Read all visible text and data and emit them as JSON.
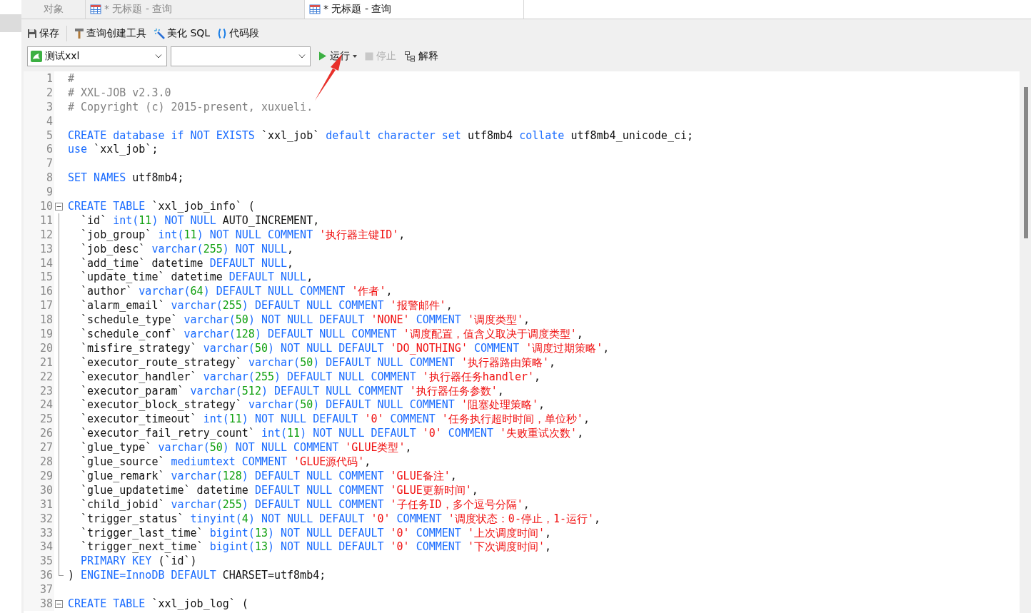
{
  "tabs": [
    {
      "kind": "objects",
      "label": "对象",
      "selected": false
    },
    {
      "kind": "query",
      "label": "* 无标题 - 查询",
      "selected": false
    },
    {
      "kind": "query",
      "label": "* 无标题 - 查询",
      "selected": true
    }
  ],
  "toolbar": [
    {
      "kind": "save",
      "label": "保存"
    },
    {
      "kind": "builder",
      "label": "查询创建工具"
    },
    {
      "kind": "beautify",
      "label": "美化 SQL"
    },
    {
      "kind": "snippet",
      "label": "代码段"
    }
  ],
  "connection": {
    "value": "测试xxl"
  },
  "actions": [
    {
      "kind": "run",
      "label": "运行",
      "disabled": false
    },
    {
      "kind": "stop",
      "label": "停止",
      "disabled": true
    },
    {
      "kind": "explain",
      "label": "解释",
      "disabled": false
    }
  ],
  "code": [
    {
      "no": "1",
      "kind": "text",
      "tokens": [
        {
          "kind": "comment",
          "text": "#"
        }
      ]
    },
    {
      "no": "2",
      "kind": "text",
      "tokens": [
        {
          "kind": "comment",
          "text": "# XXL-JOB v2.3.0"
        }
      ]
    },
    {
      "no": "3",
      "kind": "text",
      "tokens": [
        {
          "kind": "comment",
          "text": "# Copyright (c) 2015-present, xuxueli."
        }
      ]
    },
    {
      "no": "4",
      "kind": "text"
    },
    {
      "no": "5",
      "kind": "text",
      "tokens": [
        {
          "kind": "keyword",
          "text": "CREATE database if NOT EXISTS"
        },
        {
          "kind": "plain",
          "text": " `xxl_job` "
        },
        {
          "kind": "keyword",
          "text": "default character set"
        },
        {
          "kind": "plain",
          "text": " utf8mb4 "
        },
        {
          "kind": "keyword",
          "text": "collate"
        },
        {
          "kind": "plain",
          "text": " utf8mb4_unicode_ci;"
        }
      ]
    },
    {
      "no": "6",
      "kind": "text",
      "tokens": [
        {
          "kind": "keyword",
          "text": "use"
        },
        {
          "kind": "plain",
          "text": " `xxl_job`;"
        }
      ]
    },
    {
      "no": "7",
      "kind": "text"
    },
    {
      "no": "8",
      "kind": "text",
      "tokens": [
        {
          "kind": "keyword",
          "text": "SET NAMES"
        },
        {
          "kind": "plain",
          "text": " utf8mb4;"
        }
      ]
    },
    {
      "no": "9",
      "kind": "text"
    },
    {
      "no": "10",
      "kind": "fold_start",
      "tokens": [
        {
          "kind": "keyword",
          "text": "CREATE TABLE"
        },
        {
          "kind": "plain",
          "text": " `xxl_job_info` ("
        }
      ]
    },
    {
      "no": "11",
      "kind": "fold_body",
      "tokens": [
        {
          "kind": "plain",
          "text": "  `id` "
        },
        {
          "kind": "keyword",
          "text": "int("
        },
        {
          "kind": "number",
          "text": "11"
        },
        {
          "kind": "keyword",
          "text": ") NOT NULL"
        },
        {
          "kind": "plain",
          "text": " AUTO_INCREMENT,"
        }
      ]
    },
    {
      "no": "12",
      "kind": "fold_body",
      "tokens": [
        {
          "kind": "plain",
          "text": "  `job_group` "
        },
        {
          "kind": "keyword",
          "text": "int("
        },
        {
          "kind": "number",
          "text": "11"
        },
        {
          "kind": "keyword",
          "text": ") NOT NULL COMMENT "
        },
        {
          "kind": "string",
          "text": "'执行器主键ID'"
        },
        {
          "kind": "plain",
          "text": ","
        }
      ]
    },
    {
      "no": "13",
      "kind": "fold_body",
      "tokens": [
        {
          "kind": "plain",
          "text": "  `job_desc` "
        },
        {
          "kind": "keyword",
          "text": "varchar("
        },
        {
          "kind": "number",
          "text": "255"
        },
        {
          "kind": "keyword",
          "text": ") NOT NULL"
        },
        {
          "kind": "plain",
          "text": ","
        }
      ]
    },
    {
      "no": "14",
      "kind": "fold_body",
      "tokens": [
        {
          "kind": "plain",
          "text": "  `add_time` datetime "
        },
        {
          "kind": "keyword",
          "text": "DEFAULT NULL"
        },
        {
          "kind": "plain",
          "text": ","
        }
      ]
    },
    {
      "no": "15",
      "kind": "fold_body",
      "tokens": [
        {
          "kind": "plain",
          "text": "  `update_time` datetime "
        },
        {
          "kind": "keyword",
          "text": "DEFAULT NULL"
        },
        {
          "kind": "plain",
          "text": ","
        }
      ]
    },
    {
      "no": "16",
      "kind": "fold_body",
      "tokens": [
        {
          "kind": "plain",
          "text": "  `author` "
        },
        {
          "kind": "keyword",
          "text": "varchar("
        },
        {
          "kind": "number",
          "text": "64"
        },
        {
          "kind": "keyword",
          "text": ") DEFAULT NULL COMMENT "
        },
        {
          "kind": "string",
          "text": "'作者'"
        },
        {
          "kind": "plain",
          "text": ","
        }
      ]
    },
    {
      "no": "17",
      "kind": "fold_body",
      "tokens": [
        {
          "kind": "plain",
          "text": "  `alarm_email` "
        },
        {
          "kind": "keyword",
          "text": "varchar("
        },
        {
          "kind": "number",
          "text": "255"
        },
        {
          "kind": "keyword",
          "text": ") DEFAULT NULL COMMENT "
        },
        {
          "kind": "string",
          "text": "'报警邮件'"
        },
        {
          "kind": "plain",
          "text": ","
        }
      ]
    },
    {
      "no": "18",
      "kind": "fold_body",
      "tokens": [
        {
          "kind": "plain",
          "text": "  `schedule_type` "
        },
        {
          "kind": "keyword",
          "text": "varchar("
        },
        {
          "kind": "number",
          "text": "50"
        },
        {
          "kind": "keyword",
          "text": ") NOT NULL DEFAULT "
        },
        {
          "kind": "string",
          "text": "'NONE'"
        },
        {
          "kind": "keyword",
          "text": " COMMENT "
        },
        {
          "kind": "string",
          "text": "'调度类型'"
        },
        {
          "kind": "plain",
          "text": ","
        }
      ]
    },
    {
      "no": "19",
      "kind": "fold_body",
      "tokens": [
        {
          "kind": "plain",
          "text": "  `schedule_conf` "
        },
        {
          "kind": "keyword",
          "text": "varchar("
        },
        {
          "kind": "number",
          "text": "128"
        },
        {
          "kind": "keyword",
          "text": ") DEFAULT NULL COMMENT "
        },
        {
          "kind": "string",
          "text": "'调度配置，值含义取决于调度类型'"
        },
        {
          "kind": "plain",
          "text": ","
        }
      ]
    },
    {
      "no": "20",
      "kind": "fold_body",
      "tokens": [
        {
          "kind": "plain",
          "text": "  `misfire_strategy` "
        },
        {
          "kind": "keyword",
          "text": "varchar("
        },
        {
          "kind": "number",
          "text": "50"
        },
        {
          "kind": "keyword",
          "text": ") NOT NULL DEFAULT "
        },
        {
          "kind": "string",
          "text": "'DO_NOTHING'"
        },
        {
          "kind": "keyword",
          "text": " COMMENT "
        },
        {
          "kind": "string",
          "text": "'调度过期策略'"
        },
        {
          "kind": "plain",
          "text": ","
        }
      ]
    },
    {
      "no": "21",
      "kind": "fold_body",
      "tokens": [
        {
          "kind": "plain",
          "text": "  `executor_route_strategy` "
        },
        {
          "kind": "keyword",
          "text": "varchar("
        },
        {
          "kind": "number",
          "text": "50"
        },
        {
          "kind": "keyword",
          "text": ") DEFAULT NULL COMMENT "
        },
        {
          "kind": "string",
          "text": "'执行器路由策略'"
        },
        {
          "kind": "plain",
          "text": ","
        }
      ]
    },
    {
      "no": "22",
      "kind": "fold_body",
      "tokens": [
        {
          "kind": "plain",
          "text": "  `executor_handler` "
        },
        {
          "kind": "keyword",
          "text": "varchar("
        },
        {
          "kind": "number",
          "text": "255"
        },
        {
          "kind": "keyword",
          "text": ") DEFAULT NULL COMMENT "
        },
        {
          "kind": "string",
          "text": "'执行器任务handler'"
        },
        {
          "kind": "plain",
          "text": ","
        }
      ]
    },
    {
      "no": "23",
      "kind": "fold_body",
      "tokens": [
        {
          "kind": "plain",
          "text": "  `executor_param` "
        },
        {
          "kind": "keyword",
          "text": "varchar("
        },
        {
          "kind": "number",
          "text": "512"
        },
        {
          "kind": "keyword",
          "text": ") DEFAULT NULL COMMENT "
        },
        {
          "kind": "string",
          "text": "'执行器任务参数'"
        },
        {
          "kind": "plain",
          "text": ","
        }
      ]
    },
    {
      "no": "24",
      "kind": "fold_body",
      "tokens": [
        {
          "kind": "plain",
          "text": "  `executor_block_strategy` "
        },
        {
          "kind": "keyword",
          "text": "varchar("
        },
        {
          "kind": "number",
          "text": "50"
        },
        {
          "kind": "keyword",
          "text": ") DEFAULT NULL COMMENT "
        },
        {
          "kind": "string",
          "text": "'阻塞处理策略'"
        },
        {
          "kind": "plain",
          "text": ","
        }
      ]
    },
    {
      "no": "25",
      "kind": "fold_body",
      "tokens": [
        {
          "kind": "plain",
          "text": "  `executor_timeout` "
        },
        {
          "kind": "keyword",
          "text": "int("
        },
        {
          "kind": "number",
          "text": "11"
        },
        {
          "kind": "keyword",
          "text": ") NOT NULL DEFAULT "
        },
        {
          "kind": "string",
          "text": "'0'"
        },
        {
          "kind": "keyword",
          "text": " COMMENT "
        },
        {
          "kind": "string",
          "text": "'任务执行超时时间，单位秒'"
        },
        {
          "kind": "plain",
          "text": ","
        }
      ]
    },
    {
      "no": "26",
      "kind": "fold_body",
      "tokens": [
        {
          "kind": "plain",
          "text": "  `executor_fail_retry_count` "
        },
        {
          "kind": "keyword",
          "text": "int("
        },
        {
          "kind": "number",
          "text": "11"
        },
        {
          "kind": "keyword",
          "text": ") NOT NULL DEFAULT "
        },
        {
          "kind": "string",
          "text": "'0'"
        },
        {
          "kind": "keyword",
          "text": " COMMENT "
        },
        {
          "kind": "string",
          "text": "'失败重试次数'"
        },
        {
          "kind": "plain",
          "text": ","
        }
      ]
    },
    {
      "no": "27",
      "kind": "fold_body",
      "tokens": [
        {
          "kind": "plain",
          "text": "  `glue_type` "
        },
        {
          "kind": "keyword",
          "text": "varchar("
        },
        {
          "kind": "number",
          "text": "50"
        },
        {
          "kind": "keyword",
          "text": ") NOT NULL COMMENT "
        },
        {
          "kind": "string",
          "text": "'GLUE类型'"
        },
        {
          "kind": "plain",
          "text": ","
        }
      ]
    },
    {
      "no": "28",
      "kind": "fold_body",
      "tokens": [
        {
          "kind": "plain",
          "text": "  `glue_source` "
        },
        {
          "kind": "keyword",
          "text": "mediumtext COMMENT "
        },
        {
          "kind": "string",
          "text": "'GLUE源代码'"
        },
        {
          "kind": "plain",
          "text": ","
        }
      ]
    },
    {
      "no": "29",
      "kind": "fold_body",
      "tokens": [
        {
          "kind": "plain",
          "text": "  `glue_remark` "
        },
        {
          "kind": "keyword",
          "text": "varchar("
        },
        {
          "kind": "number",
          "text": "128"
        },
        {
          "kind": "keyword",
          "text": ") DEFAULT NULL COMMENT "
        },
        {
          "kind": "string",
          "text": "'GLUE备注'"
        },
        {
          "kind": "plain",
          "text": ","
        }
      ]
    },
    {
      "no": "30",
      "kind": "fold_body",
      "tokens": [
        {
          "kind": "plain",
          "text": "  `glue_updatetime` datetime "
        },
        {
          "kind": "keyword",
          "text": "DEFAULT NULL COMMENT "
        },
        {
          "kind": "string",
          "text": "'GLUE更新时间'"
        },
        {
          "kind": "plain",
          "text": ","
        }
      ]
    },
    {
      "no": "31",
      "kind": "fold_body",
      "tokens": [
        {
          "kind": "plain",
          "text": "  `child_jobid` "
        },
        {
          "kind": "keyword",
          "text": "varchar("
        },
        {
          "kind": "number",
          "text": "255"
        },
        {
          "kind": "keyword",
          "text": ") DEFAULT NULL COMMENT "
        },
        {
          "kind": "string",
          "text": "'子任务ID，多个逗号分隔'"
        },
        {
          "kind": "plain",
          "text": ","
        }
      ]
    },
    {
      "no": "32",
      "kind": "fold_body",
      "tokens": [
        {
          "kind": "plain",
          "text": "  `trigger_status` "
        },
        {
          "kind": "keyword",
          "text": "tinyint("
        },
        {
          "kind": "number",
          "text": "4"
        },
        {
          "kind": "keyword",
          "text": ") NOT NULL DEFAULT "
        },
        {
          "kind": "string",
          "text": "'0'"
        },
        {
          "kind": "keyword",
          "text": " COMMENT "
        },
        {
          "kind": "string",
          "text": "'调度状态：0-停止，1-运行'"
        },
        {
          "kind": "plain",
          "text": ","
        }
      ]
    },
    {
      "no": "33",
      "kind": "fold_body",
      "tokens": [
        {
          "kind": "plain",
          "text": "  `trigger_last_time` "
        },
        {
          "kind": "keyword",
          "text": "bigint("
        },
        {
          "kind": "number",
          "text": "13"
        },
        {
          "kind": "keyword",
          "text": ") NOT NULL DEFAULT "
        },
        {
          "kind": "string",
          "text": "'0'"
        },
        {
          "kind": "keyword",
          "text": " COMMENT "
        },
        {
          "kind": "string",
          "text": "'上次调度时间'"
        },
        {
          "kind": "plain",
          "text": ","
        }
      ]
    },
    {
      "no": "34",
      "kind": "fold_body",
      "tokens": [
        {
          "kind": "plain",
          "text": "  `trigger_next_time` "
        },
        {
          "kind": "keyword",
          "text": "bigint("
        },
        {
          "kind": "number",
          "text": "13"
        },
        {
          "kind": "keyword",
          "text": ") NOT NULL DEFAULT "
        },
        {
          "kind": "string",
          "text": "'0'"
        },
        {
          "kind": "keyword",
          "text": " COMMENT "
        },
        {
          "kind": "string",
          "text": "'下次调度时间'"
        },
        {
          "kind": "plain",
          "text": ","
        }
      ]
    },
    {
      "no": "35",
      "kind": "fold_body",
      "tokens": [
        {
          "kind": "keyword",
          "text": "  PRIMARY KEY"
        },
        {
          "kind": "plain",
          "text": " (`id`)"
        }
      ]
    },
    {
      "no": "36",
      "kind": "fold_end",
      "tokens": [
        {
          "kind": "plain",
          "text": ") "
        },
        {
          "kind": "keyword",
          "text": "ENGINE=InnoDB DEFAULT"
        },
        {
          "kind": "plain",
          "text": " CHARSET=utf8mb4;"
        }
      ]
    },
    {
      "no": "37",
      "kind": "text"
    },
    {
      "no": "38",
      "kind": "fold_start",
      "tokens": [
        {
          "kind": "keyword",
          "text": "CREATE TABLE"
        },
        {
          "kind": "plain",
          "text": " `xxl_job_log` ("
        }
      ]
    }
  ]
}
